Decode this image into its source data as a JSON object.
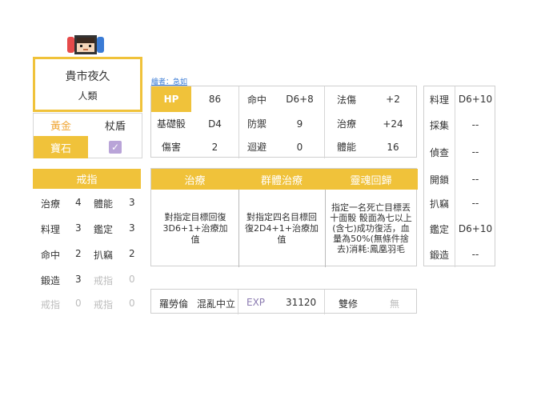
{
  "character": {
    "name": "貴市夜久",
    "race": "人類",
    "author_link": "繪者：急如"
  },
  "equip": {
    "tab_gold": "黃金",
    "tab_shield": "杖盾",
    "gem_label": "寶石"
  },
  "rings": {
    "header": "戒指",
    "rows": [
      [
        "治療",
        "4",
        "體能",
        "3"
      ],
      [
        "料理",
        "3",
        "鑑定",
        "3"
      ],
      [
        "命中",
        "2",
        "扒竊",
        "2"
      ],
      [
        "鍛造",
        "3",
        "戒指",
        "0"
      ],
      [
        "戒指",
        "0",
        "戒指",
        "0"
      ]
    ]
  },
  "stats": {
    "hp_label": "HP",
    "hp_value": "86",
    "hit_label": "命中",
    "hit_value": "D6+8",
    "mag_label": "法傷",
    "mag_value": "+2",
    "base_label": "基礎骰",
    "base_value": "D4",
    "def_label": "防禦",
    "def_value": "9",
    "heal_label": "治療",
    "heal_value": "+24",
    "dmg_label": "傷害",
    "dmg_value": "2",
    "eva_label": "迴避",
    "eva_value": "0",
    "stam_label": "體能",
    "stam_value": "16"
  },
  "skills": [
    {
      "name": "治療",
      "desc": "對指定目標回復3D6+1+治療加值"
    },
    {
      "name": "群體治療",
      "desc": "對指定四名目標回復2D4+1+治療加值"
    },
    {
      "name": "靈魂回歸",
      "desc": "指定一名死亡目標丟十面骰 骰面為七以上(含七)成功復活，血量為50%(無條件捨去)消耗:鳳凰羽毛"
    }
  ],
  "bottom": {
    "role": "羅勞倫",
    "alignment": "混亂中立",
    "exp_label": "EXP",
    "exp_value": "31120",
    "dual_label": "雙修",
    "dual_value": "無"
  },
  "life_skills": [
    {
      "label": "料理",
      "value": "D6+10"
    },
    {
      "label": "採集",
      "value": "--"
    },
    {
      "label": "偵查",
      "value": "--"
    },
    {
      "label": "開鎖",
      "value": "--"
    },
    {
      "label": "扒竊",
      "value": "--"
    },
    {
      "label": "鑑定",
      "value": "D6+10"
    },
    {
      "label": "鍛造",
      "value": "--"
    }
  ],
  "colors": {
    "accent": "#f0c23a",
    "check": "#b9a4d8",
    "exp": "#8a7ab0"
  }
}
